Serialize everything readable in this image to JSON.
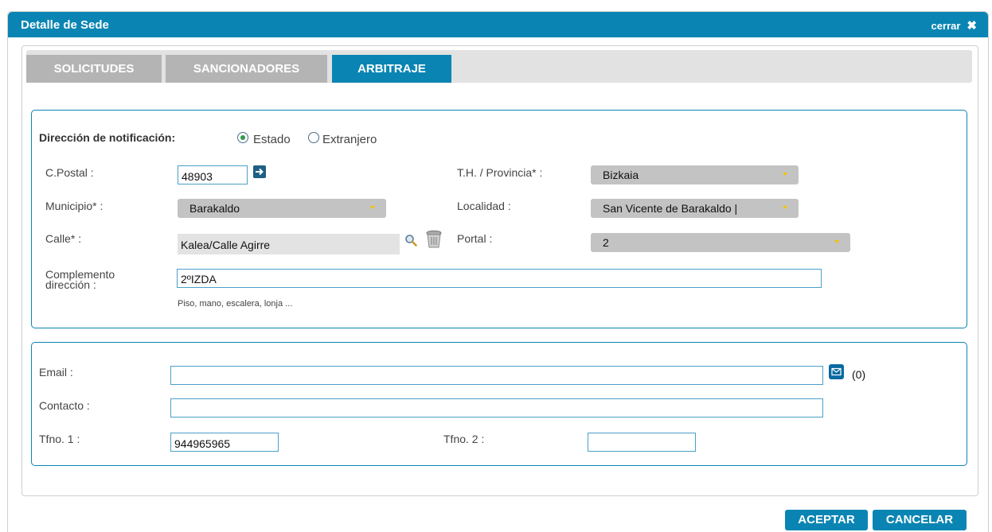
{
  "dialog": {
    "title": "Detalle de Sede",
    "close_label": "cerrar",
    "close_icon": "✖"
  },
  "tabs": [
    {
      "label": "SOLICITUDES",
      "active": false
    },
    {
      "label": "SANCIONADORES",
      "active": false
    },
    {
      "label": "ARBITRAJE",
      "active": true
    }
  ],
  "address": {
    "heading": "Dirección de notificación:",
    "radio_estado": "Estado",
    "radio_extranjero": "Extranjero",
    "selected": "Estado",
    "cpostal_label": "C.Postal :",
    "cpostal_value": "48903",
    "provincia_label": "T.H. / Provincia* :",
    "provincia_value": "Bizkaia",
    "municipio_label": "Municipio* :",
    "municipio_value": "Barakaldo",
    "localidad_label": "Localidad :",
    "localidad_value": "San Vicente de Barakaldo |",
    "calle_label": "Calle* :",
    "calle_value": "Kalea/Calle Agirre",
    "portal_label": "Portal :",
    "portal_value": "2",
    "complemento_label_1": "Complemento",
    "complemento_label_2": "dirección :",
    "complemento_value": "2ºIZDA",
    "complemento_hint": "Piso, mano, escalera, lonja ..."
  },
  "contact": {
    "email_label": "Email :",
    "email_value": "",
    "email_count": "(0)",
    "contacto_label": "Contacto :",
    "contacto_value": "",
    "tfno1_label": "Tfno. 1 :",
    "tfno1_value": "944965965",
    "tfno2_label": "Tfno. 2 :",
    "tfno2_value": ""
  },
  "buttons": {
    "accept": "ACEPTAR",
    "cancel": "CANCELAR"
  },
  "colors": {
    "accent": "#0a85b3",
    "tab_inactive": "#b4b4b4",
    "select_bg": "#c3c3c3",
    "caret": "#f3c300"
  }
}
